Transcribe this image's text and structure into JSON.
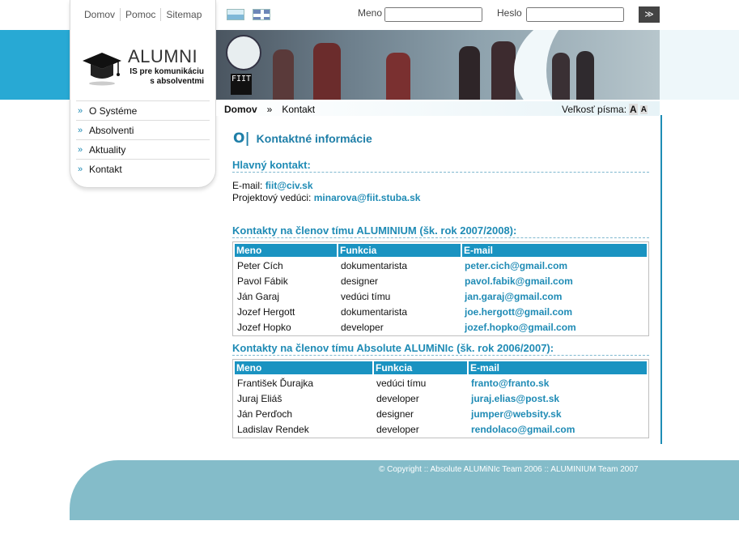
{
  "topnav": {
    "home": "Domov",
    "help": "Pomoc",
    "sitemap": "Sitemap"
  },
  "language_flags": [
    {
      "icon": "slovak-flag-icon"
    },
    {
      "icon": "english-flag-icon"
    }
  ],
  "login": {
    "name_label": "Meno",
    "password_label": "Heslo",
    "submit_label": "≫"
  },
  "logo": {
    "title": "ALUMNI",
    "subtitle_line1": "IS pre komunikáciu",
    "subtitle_line2": "s absolventmi"
  },
  "banner": {
    "fiit_logo": "FIIT"
  },
  "sidebar": {
    "items": [
      {
        "label": "O Systéme"
      },
      {
        "label": "Absolventi"
      },
      {
        "label": "Aktuality"
      },
      {
        "label": "Kontakt"
      }
    ]
  },
  "breadcrumb": {
    "home": "Domov",
    "separator": "»",
    "current": "Kontakt"
  },
  "font_size": {
    "label": "Veľkosť písma:",
    "larger": "A",
    "smaller": "A"
  },
  "main": {
    "title": "Kontaktné informácie",
    "main_contact": {
      "title": "Hlavný kontakt:",
      "email_label": "E-mail:",
      "email": "fiit@civ.sk",
      "leader_label": "Projektový vedúci:",
      "leader_email": "minarova@fiit.stuba.sk"
    },
    "team1": {
      "title": "Kontakty na členov tímu ALUMINIUM (šk. rok 2007/2008):",
      "headers": [
        "Meno",
        "Funkcia",
        "E-mail"
      ],
      "rows": [
        [
          "Peter Cích",
          "dokumentarista",
          "peter.cich@gmail.com"
        ],
        [
          "Pavol Fábik",
          "designer",
          "pavol.fabik@gmail.com"
        ],
        [
          "Ján Garaj",
          "vedúci tímu",
          "jan.garaj@gmail.com"
        ],
        [
          "Jozef Hergott",
          "dokumentarista",
          "joe.hergott@gmail.com"
        ],
        [
          "Jozef Hopko",
          "developer",
          "jozef.hopko@gmail.com"
        ]
      ]
    },
    "team2": {
      "title": "Kontakty na členov tímu Absolute ALUMiNIc (šk. rok 2006/2007):",
      "headers": [
        "Meno",
        "Funkcia",
        "E-mail"
      ],
      "rows": [
        [
          "František Ďurajka",
          "vedúci tímu",
          "franto@franto.sk"
        ],
        [
          "Juraj Eliáš",
          "developer",
          "juraj.elias@post.sk"
        ],
        [
          "Ján Perďoch",
          "designer",
          "jumper@websity.sk"
        ],
        [
          "Ladislav Rendek",
          "developer",
          "rendolaco@gmail.com"
        ]
      ]
    }
  },
  "footer": {
    "copyright": "© Copyright :: Absolute ALUMiNIc Team 2006 :: ALUMINIUM Team 2007"
  },
  "colors": {
    "accent": "#1f8bb5",
    "header_cell": "#1a93c1",
    "band": "#28a9d4",
    "footer": "#84bcc9"
  }
}
